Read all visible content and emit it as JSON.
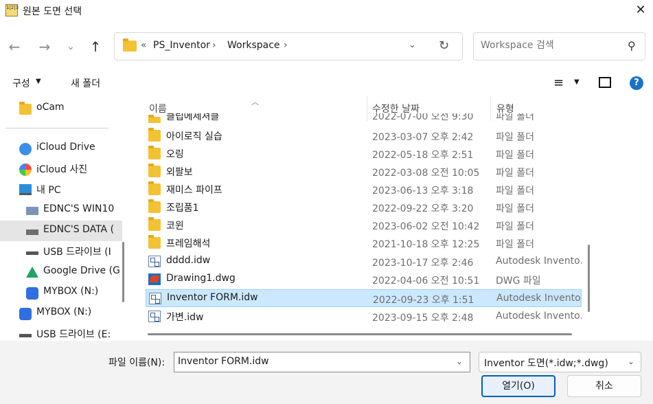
{
  "window": {
    "title": "원본 도면 선택",
    "app_icon_text": "1|2|3"
  },
  "nav_buttons": {
    "back": "←",
    "forward": "→",
    "recent": "⌄",
    "up": "↑"
  },
  "address": {
    "overflow": "«",
    "crumbs": [
      "PS_Inventor",
      "Workspace"
    ],
    "separator": "›"
  },
  "search": {
    "placeholder": "Workspace 검색"
  },
  "commandbar": {
    "organize": "구성",
    "new_folder": "새 폴더"
  },
  "nav_pane": {
    "items": [
      {
        "label": "oCam",
        "icon": "folder-icon"
      },
      {
        "label": "iCloud Drive",
        "icon": "icloud-icon"
      },
      {
        "label": "iCloud 사진",
        "icon": "photos-icon"
      },
      {
        "label": "내 PC",
        "icon": "pc-icon"
      },
      {
        "label": "EDNC'S WIN10",
        "icon": "network-drive-icon"
      },
      {
        "label": "EDNC'S DATA (",
        "icon": "network-drive-icon"
      },
      {
        "label": "USB 드라이브 (I",
        "icon": "usb-drive-icon"
      },
      {
        "label": "Google Drive (G",
        "icon": "google-drive-icon"
      },
      {
        "label": "MYBOX (N:)",
        "icon": "mybox-icon"
      },
      {
        "label": "MYBOX (N:)",
        "icon": "mybox-icon"
      },
      {
        "label": "USB 드라이브 (E:",
        "icon": "usb-drive-icon"
      }
    ]
  },
  "file_list": {
    "columns": {
      "name": "이름",
      "date": "수정한 날짜",
      "type": "유형"
    },
    "partial_top_row": {
      "name": "클립에제셔클",
      "date": "2022-07-00 오전 9:30",
      "type": "파일 폴더"
    },
    "rows": [
      {
        "name": "아이로직 실습",
        "date": "2023-03-07 오후 2:42",
        "type": "파일 폴더",
        "icon": "folder-icon"
      },
      {
        "name": "오링",
        "date": "2022-05-18 오후 2:51",
        "type": "파일 폴더",
        "icon": "folder-icon"
      },
      {
        "name": "외팔보",
        "date": "2022-03-08 오전 10:05",
        "type": "파일 폴더",
        "icon": "folder-icon"
      },
      {
        "name": "재미스 파이프",
        "date": "2023-06-13 오후 3:18",
        "type": "파일 폴더",
        "icon": "folder-icon"
      },
      {
        "name": "조립품1",
        "date": "2022-09-22 오후 3:20",
        "type": "파일 폴더",
        "icon": "folder-icon"
      },
      {
        "name": "코윈",
        "date": "2023-06-02 오전 10:42",
        "type": "파일 폴더",
        "icon": "folder-icon"
      },
      {
        "name": "프레임해석",
        "date": "2021-10-18 오후 12:25",
        "type": "파일 폴더",
        "icon": "folder-icon"
      },
      {
        "name": "dddd.idw",
        "date": "2023-10-17 오후 2:46",
        "type": "Autodesk Invento...",
        "icon": "idw-icon"
      },
      {
        "name": "Drawing1.dwg",
        "date": "2022-04-06 오전 10:51",
        "type": "DWG 파일",
        "icon": "dwg-icon"
      },
      {
        "name": "Inventor FORM.idw",
        "date": "2022-09-23 오후 1:51",
        "type": "Autodesk Invento...",
        "icon": "idw-icon",
        "selected": true
      },
      {
        "name": "가변.idw",
        "date": "2023-09-15 오후 2:48",
        "type": "Autodesk Invento...",
        "icon": "idw-icon"
      }
    ]
  },
  "footer": {
    "filename_label": "파일 이름(N):",
    "filename_value": "Inventor FORM.idw",
    "filetype": "Inventor 도면(*.idw;*.dwg)",
    "open": "열기(O)",
    "cancel": "취소"
  },
  "colors": {
    "accent": "#005fb8",
    "selection": "#cce8ff",
    "folder": "#f3c233"
  }
}
